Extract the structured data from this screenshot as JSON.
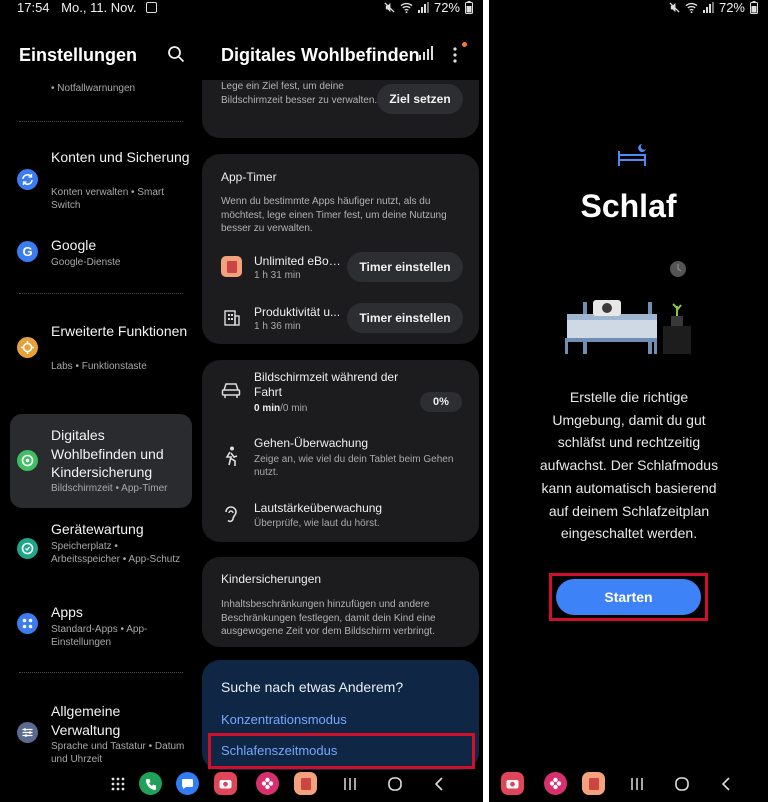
{
  "status_left": {
    "time": "17:54",
    "date": "Mo., 11. Nov."
  },
  "status_right": {
    "battery": "72%"
  },
  "settings": {
    "title": "Einstellungen",
    "top_sub": "• Notfallwarnungen",
    "items": [
      {
        "label": "Konten und Sicherung",
        "desc": "Konten verwalten • Smart Switch",
        "color": "#3b7cf0"
      },
      {
        "label": "Google",
        "desc": "Google-Dienste",
        "color": "#3b7cf0"
      },
      {
        "label": "Erweiterte Funktionen",
        "desc": "Labs • Funktionstaste",
        "color": "#e6a23a"
      },
      {
        "label": "Digitales Wohlbefinden und Kindersicherung",
        "desc": "Bildschirmzeit • App-Timer",
        "color": "#3fbf63"
      },
      {
        "label": "Gerätewartung",
        "desc": "Speicherplatz • Arbeitsspeicher • App-Schutz",
        "color": "#1ea68a"
      },
      {
        "label": "Apps",
        "desc": "Standard-Apps • App-Einstellungen",
        "color": "#3b7cf0"
      },
      {
        "label": "Allgemeine Verwaltung",
        "desc": "Sprache und Tastatur • Datum und Uhrzeit",
        "color": "#5a6b8f"
      }
    ]
  },
  "wellbeing": {
    "title": "Digitales Wohlbefinden",
    "goal_text": "Lege ein Ziel fest, um deine Bildschirmzeit besser zu verwalten.",
    "goal_button": "Ziel setzen",
    "app_timer": {
      "title": "App-Timer",
      "text": "Wenn du bestimmte Apps häufiger nutzt, als du möchtest, lege einen Timer fest, um deine Nutzung besser zu verwalten.",
      "apps": [
        {
          "name": "Unlimited eBoo...",
          "time": "1 h 31 min",
          "button": "Timer einstellen"
        },
        {
          "name": "Produktivität u...",
          "time": "1 h 36 min",
          "button": "Timer einstellen"
        }
      ]
    },
    "driving": {
      "title": "Bildschirmzeit während der Fahrt",
      "value": "0 min",
      "value_rest": "/0 min",
      "percent": "0%"
    },
    "walking": {
      "title": "Gehen-Überwachung",
      "text": "Zeige an, wie viel du dein Tablet beim Gehen nutzt."
    },
    "volume": {
      "title": "Lautstärkeüberwachung",
      "text": "Überprüfe, wie laut du hörst."
    },
    "parental": {
      "title": "Kindersicherungen",
      "text": "Inhaltsbeschränkungen hinzufügen und andere Beschränkungen festlegen, damit dein Kind eine ausgewogene Zeit vor dem Bildschirm verbringt."
    },
    "search": {
      "title": "Suche nach etwas Anderem?",
      "link1": "Konzentrationsmodus",
      "link2": "Schlafenszeitmodus"
    }
  },
  "sleep": {
    "title": "Schlaf",
    "text": "Erstelle die richtige Umgebung, damit du gut schläfst und rechtzeitig aufwachst. Der Schlafmodus kann automatisch basierend auf deinem Schlafzeitplan eingeschaltet werden.",
    "button": "Starten"
  },
  "colors": {
    "highlight": "#d0102b",
    "link": "#74a7ff",
    "primary_button": "#3e82f7"
  }
}
